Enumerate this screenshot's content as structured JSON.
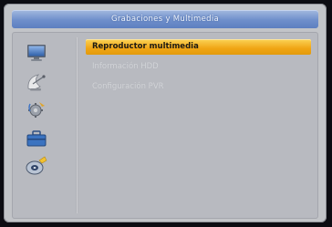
{
  "window": {
    "title": "Grabaciones y Multimedia"
  },
  "sidebar": {
    "icons": [
      {
        "name": "monitor-icon"
      },
      {
        "name": "satellite-dish-icon"
      },
      {
        "name": "gear-settings-icon"
      },
      {
        "name": "toolbox-icon"
      },
      {
        "name": "media-disc-icon"
      }
    ]
  },
  "menu": {
    "items": [
      {
        "label": "Reproductor multimedia",
        "selected": true
      },
      {
        "label": "Información  HDD",
        "selected": false
      },
      {
        "label": "Configuración PVR",
        "selected": false
      }
    ]
  },
  "colors": {
    "title_bar": "#6f8fcb",
    "highlight": "#f0a514",
    "panel": "#b8bac0"
  }
}
